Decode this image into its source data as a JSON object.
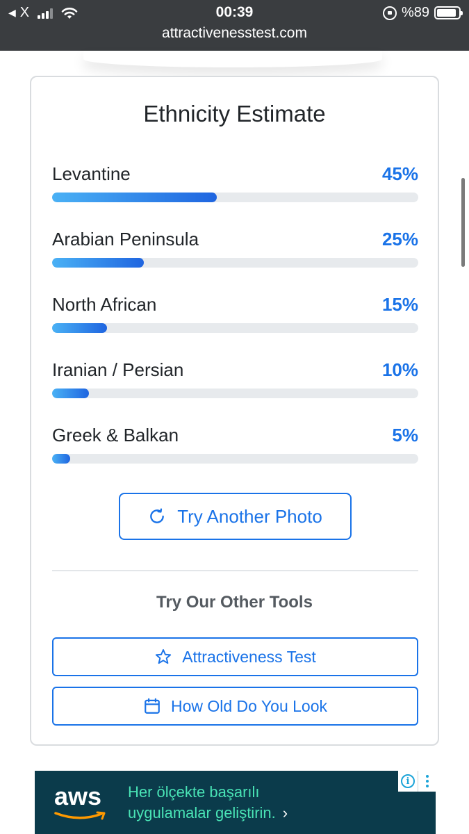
{
  "status_bar": {
    "carrier": "X",
    "time": "00:39",
    "url": "attractivenesstest.com",
    "battery_text": "%89",
    "battery_level": 0.89,
    "icons": [
      "back-arrow-icon",
      "signal-icon",
      "wifi-icon",
      "rotation-lock-icon",
      "battery-icon"
    ]
  },
  "card": {
    "title": "Ethnicity Estimate",
    "results": [
      {
        "label": "Levantine",
        "percent_text": "45%",
        "value": 45
      },
      {
        "label": "Arabian Peninsula",
        "percent_text": "25%",
        "value": 25
      },
      {
        "label": "North African",
        "percent_text": "15%",
        "value": 15
      },
      {
        "label": "Iranian / Persian",
        "percent_text": "10%",
        "value": 10
      },
      {
        "label": "Greek & Balkan",
        "percent_text": "5%",
        "value": 5
      }
    ],
    "try_button": {
      "label": "Try Another Photo",
      "icon": "refresh-icon"
    },
    "tools_title": "Try Our Other Tools",
    "tools": [
      {
        "label": "Attractiveness Test",
        "icon": "star-icon"
      },
      {
        "label": "How Old Do You Look",
        "icon": "calendar-icon"
      }
    ]
  },
  "ad": {
    "brand": "aws",
    "line1": "Her ölçekte başarılı",
    "line2": "uygulamalar geliştirin.",
    "chevron": "›",
    "info_glyph": "i",
    "background_color": "#0b3b4b",
    "text_color": "#49e3b5"
  },
  "colors": {
    "accent": "#1a73e8",
    "bar_gradient_start": "#4ab1f5",
    "bar_gradient_end": "#1f65e0",
    "track": "#e7eaed",
    "status_bar_bg": "#3a3d40"
  }
}
